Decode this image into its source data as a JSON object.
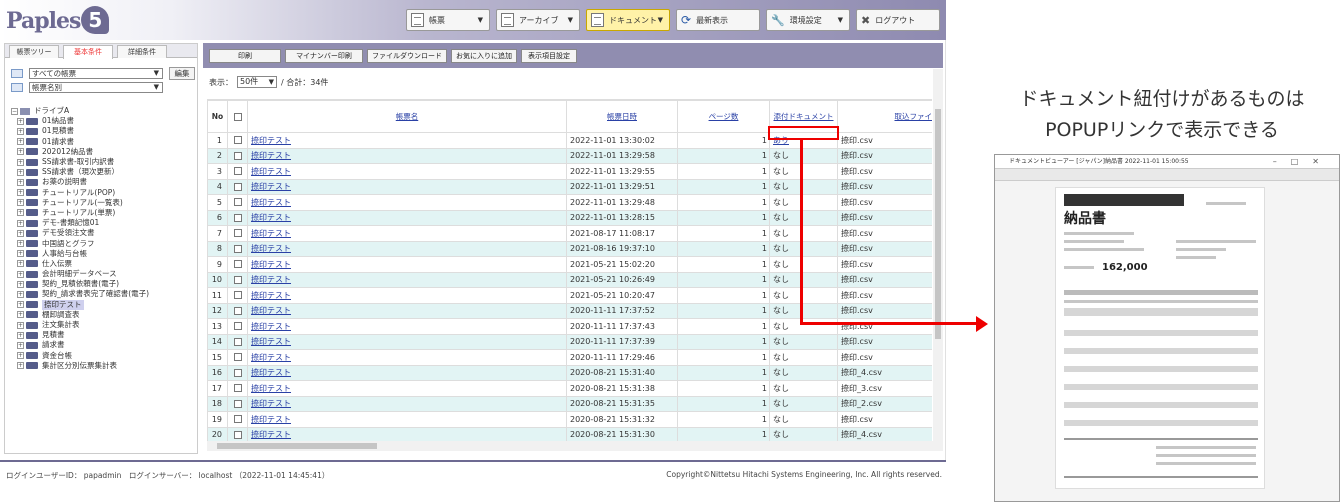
{
  "header": {
    "logo": {
      "text": "Paples",
      "number": "5"
    },
    "buttons": [
      {
        "label": "帳票",
        "icon": "document-icon",
        "dropdown": true
      },
      {
        "label": "アーカイブ",
        "icon": "archive-icon",
        "dropdown": true
      },
      {
        "label": "ドキュメント",
        "icon": "document-icon",
        "dropdown": true,
        "active": true
      },
      {
        "label": "最新表示",
        "icon": "refresh-icon",
        "dropdown": false
      },
      {
        "label": "環境設定",
        "icon": "wrench-icon",
        "dropdown": true
      },
      {
        "label": "ログアウト",
        "icon": "close-icon",
        "dropdown": false
      }
    ]
  },
  "left_panel": {
    "tabs": [
      "帳票ツリー",
      "基本条件",
      "詳細条件"
    ],
    "selected_tab": "基本条件",
    "group_select": "すべての帳票",
    "sort_select": "帳票名別",
    "edit_label": "編集",
    "tree_root": "ドライブA",
    "tree_items": [
      "01納品書",
      "01見積書",
      "01請求書",
      "202012納品書",
      "SS請求書-取引内訳書",
      "SS請求書（現次更新）",
      "お薬の説明書",
      "チュートリアル(POP)",
      "チュートリアル(一覧表)",
      "チュートリアル(単票)",
      "デモ-書類記憶01",
      "デモ受領注文書",
      "中国語とグラフ",
      "人事給与台帳",
      "仕入伝票",
      "会計明細データベース",
      "契約_見積依頼書(電子)",
      "契約_請求書表完了確認書(電子)",
      "捺印テスト",
      "棚卸調査表",
      "注文集計表",
      "見積書",
      "請求書",
      "資金台帳",
      "集計区分別伝票集計表"
    ],
    "highlighted_item": "捺印テスト"
  },
  "toolbar": {
    "buttons": [
      "印刷",
      "マイナンバー印刷",
      "ファイルダウンロード",
      "お気に入りに追加",
      "表示項目設定"
    ]
  },
  "pager": {
    "display_label": "表示：",
    "per_page": "50件",
    "total": "/ 合計：34件"
  },
  "table": {
    "columns": [
      "No",
      "",
      "帳票名",
      "帳票日時",
      "ページ数",
      "添付ドキュメント",
      "取込ファイ"
    ],
    "rows": [
      {
        "no": "1",
        "name": "捺印テスト",
        "datetime": "2022-11-01 13:30:02",
        "pages": "1",
        "attach": "あり",
        "file": "捺印.csv"
      },
      {
        "no": "2",
        "name": "捺印テスト",
        "datetime": "2022-11-01 13:29:58",
        "pages": "1",
        "attach": "なし",
        "file": "捺印.csv"
      },
      {
        "no": "3",
        "name": "捺印テスト",
        "datetime": "2022-11-01 13:29:55",
        "pages": "1",
        "attach": "なし",
        "file": "捺印.csv"
      },
      {
        "no": "4",
        "name": "捺印テスト",
        "datetime": "2022-11-01 13:29:51",
        "pages": "1",
        "attach": "なし",
        "file": "捺印.csv"
      },
      {
        "no": "5",
        "name": "捺印テスト",
        "datetime": "2022-11-01 13:29:48",
        "pages": "1",
        "attach": "なし",
        "file": "捺印.csv"
      },
      {
        "no": "6",
        "name": "捺印テスト",
        "datetime": "2022-11-01 13:28:15",
        "pages": "1",
        "attach": "なし",
        "file": "捺印.csv"
      },
      {
        "no": "7",
        "name": "捺印テスト",
        "datetime": "2021-08-17 11:08:17",
        "pages": "1",
        "attach": "なし",
        "file": "捺印.csv"
      },
      {
        "no": "8",
        "name": "捺印テスト",
        "datetime": "2021-08-16 19:37:10",
        "pages": "1",
        "attach": "なし",
        "file": "捺印.csv"
      },
      {
        "no": "9",
        "name": "捺印テスト",
        "datetime": "2021-05-21 15:02:20",
        "pages": "1",
        "attach": "なし",
        "file": "捺印.csv"
      },
      {
        "no": "10",
        "name": "捺印テスト",
        "datetime": "2021-05-21 10:26:49",
        "pages": "1",
        "attach": "なし",
        "file": "捺印.csv"
      },
      {
        "no": "11",
        "name": "捺印テスト",
        "datetime": "2021-05-21 10:20:47",
        "pages": "1",
        "attach": "なし",
        "file": "捺印.csv"
      },
      {
        "no": "12",
        "name": "捺印テスト",
        "datetime": "2020-11-11 17:37:52",
        "pages": "1",
        "attach": "なし",
        "file": "捺印.csv"
      },
      {
        "no": "13",
        "name": "捺印テスト",
        "datetime": "2020-11-11 17:37:43",
        "pages": "1",
        "attach": "なし",
        "file": "捺印.csv"
      },
      {
        "no": "14",
        "name": "捺印テスト",
        "datetime": "2020-11-11 17:37:39",
        "pages": "1",
        "attach": "なし",
        "file": "捺印.csv"
      },
      {
        "no": "15",
        "name": "捺印テスト",
        "datetime": "2020-11-11 17:29:46",
        "pages": "1",
        "attach": "なし",
        "file": "捺印.csv"
      },
      {
        "no": "16",
        "name": "捺印テスト",
        "datetime": "2020-08-21 15:31:40",
        "pages": "1",
        "attach": "なし",
        "file": "捺印_4.csv"
      },
      {
        "no": "17",
        "name": "捺印テスト",
        "datetime": "2020-08-21 15:31:38",
        "pages": "1",
        "attach": "なし",
        "file": "捺印_3.csv"
      },
      {
        "no": "18",
        "name": "捺印テスト",
        "datetime": "2020-08-21 15:31:35",
        "pages": "1",
        "attach": "なし",
        "file": "捺印_2.csv"
      },
      {
        "no": "19",
        "name": "捺印テスト",
        "datetime": "2020-08-21 15:31:32",
        "pages": "1",
        "attach": "なし",
        "file": "捺印.csv"
      },
      {
        "no": "20",
        "name": "捺印テスト",
        "datetime": "2020-08-21 15:31:30",
        "pages": "1",
        "attach": "なし",
        "file": "捺印_4.csv"
      }
    ]
  },
  "footer": {
    "user_info": "ログインユーザーID： papadmin　ログインサーバー： localhost （2022-11-01 14:45:41）",
    "copyright": "Copyright©Nittetsu Hitachi Systems Engineering, Inc. All rights reserved."
  },
  "annotation": {
    "line1": "ドキュメント紐付けがあるものは",
    "line2": "POPUPリンクで表示できる",
    "color": "#e00000"
  },
  "popup": {
    "title": "ドキュメントビューアー [ジャパン]納品書 2022-11-01 15:00:55",
    "doc_title": "納品書",
    "amount": "162,000"
  }
}
